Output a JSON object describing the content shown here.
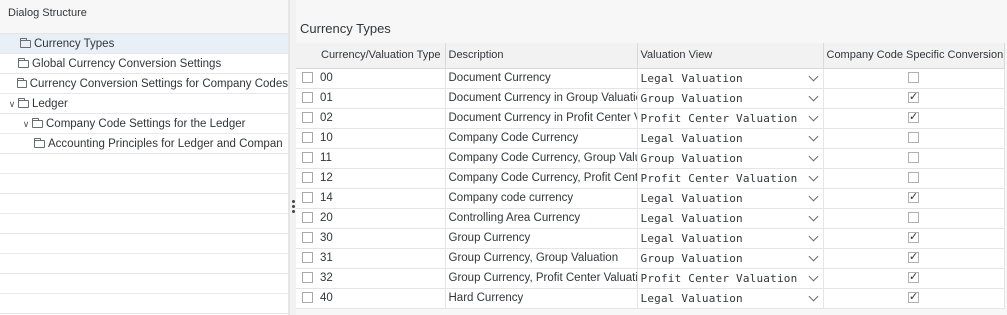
{
  "dialog_structure": {
    "header": "Dialog Structure",
    "items": [
      {
        "label": "Currency Types",
        "level": 1,
        "expandable": false,
        "selected": true
      },
      {
        "label": "Global Currency Conversion Settings",
        "level": 0,
        "expandable": false,
        "selected": false
      },
      {
        "label": "Currency Conversion Settings for Company Codes",
        "level": 0,
        "expandable": false,
        "selected": false
      },
      {
        "label": "Ledger",
        "level": 0,
        "expandable": true,
        "selected": false
      },
      {
        "label": "Company Code Settings for the Ledger",
        "level": 1,
        "expandable": true,
        "selected": false
      },
      {
        "label": "Accounting Principles for Ledger and Compan",
        "level": 2,
        "expandable": false,
        "selected": false
      }
    ]
  },
  "main": {
    "title": "Currency Types",
    "columns": {
      "type": "Currency/Valuation Type",
      "description": "Description",
      "valuation_view": "Valuation View",
      "cc_specific": "Company Code Specific Conversion"
    },
    "rows": [
      {
        "type": "00",
        "description": "Document Currency",
        "valuation_view": "Legal Valuation",
        "cc_specific": false
      },
      {
        "type": "01",
        "description": "Document Currency in Group Valuatio",
        "valuation_view": "Group Valuation",
        "cc_specific": true
      },
      {
        "type": "02",
        "description": "Document Currency in Profit Center V",
        "valuation_view": "Profit Center Valuation",
        "cc_specific": true
      },
      {
        "type": "10",
        "description": "Company Code Currency",
        "valuation_view": "Legal Valuation",
        "cc_specific": false
      },
      {
        "type": "11",
        "description": "Company Code Currency, Group Valu",
        "valuation_view": "Group Valuation",
        "cc_specific": false
      },
      {
        "type": "12",
        "description": "Company Code Currency, Profit Cent",
        "valuation_view": "Profit Center Valuation",
        "cc_specific": false
      },
      {
        "type": "14",
        "description": "Company code currency",
        "valuation_view": "Legal Valuation",
        "cc_specific": true
      },
      {
        "type": "20",
        "description": "Controlling Area Currency",
        "valuation_view": "Legal Valuation",
        "cc_specific": false
      },
      {
        "type": "30",
        "description": "Group Currency",
        "valuation_view": "Legal Valuation",
        "cc_specific": true
      },
      {
        "type": "31",
        "description": "Group Currency, Group Valuation",
        "valuation_view": "Group Valuation",
        "cc_specific": true
      },
      {
        "type": "32",
        "description": "Group Currency, Profit Center Valuati",
        "valuation_view": "Profit Center Valuation",
        "cc_specific": true
      },
      {
        "type": "40",
        "description": "Hard Currency",
        "valuation_view": "Legal Valuation",
        "cc_specific": true
      }
    ]
  }
}
